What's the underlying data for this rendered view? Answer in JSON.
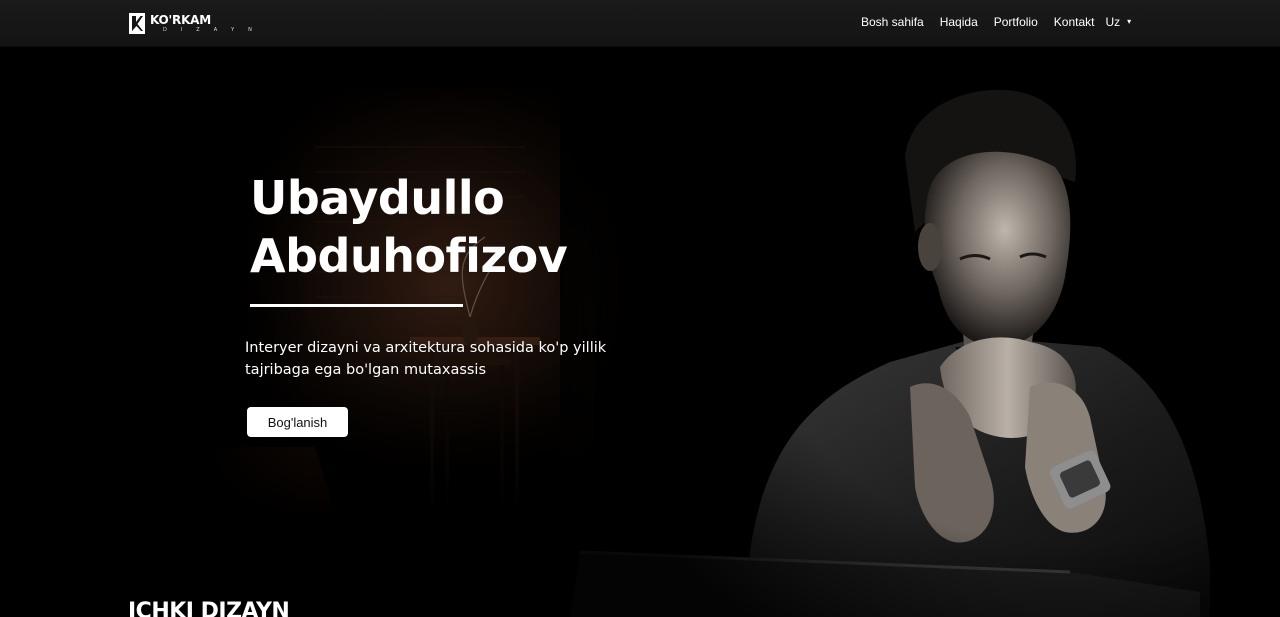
{
  "brand": {
    "name": "KO'RKAM",
    "subtitle": "D I Z A Y N",
    "logo_icon": "k-logo-icon"
  },
  "nav": {
    "items": [
      {
        "label": "Bosh sahifa"
      },
      {
        "label": "Haqida"
      },
      {
        "label": "Portfolio"
      },
      {
        "label": "Kontakt"
      }
    ],
    "language": {
      "selected": "Uz",
      "icon": "chevron-down-icon"
    }
  },
  "hero": {
    "name_line1": "Ubaydullo",
    "name_line2": "Abduhofizov",
    "description": "Interyer dizayni va arxitektura sohasida ko'p yillik tajribaga ega bo'lgan mutaxassis",
    "button_label": "Bog'lanish"
  },
  "section": {
    "title": "ICHKI DIZAYN"
  },
  "colors": {
    "background": "#000000",
    "navbar": "#161616",
    "text": "#ffffff",
    "button_bg": "#ffffff"
  }
}
